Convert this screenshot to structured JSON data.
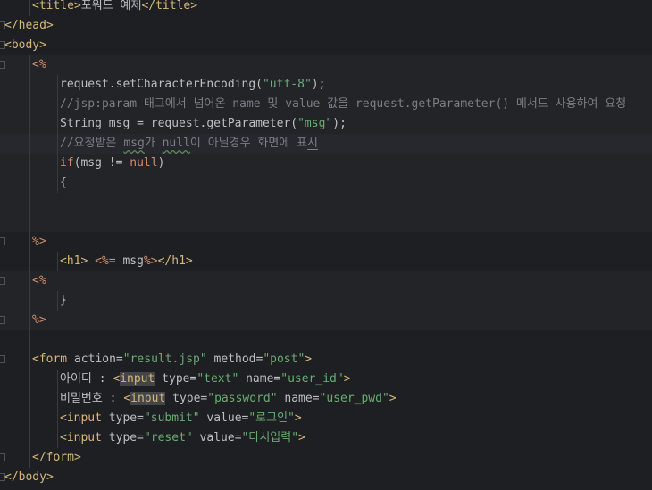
{
  "editor": {
    "lines": [
      {
        "indent": 1,
        "style": "",
        "tokens": [
          {
            "t": "<title>",
            "c": "tag"
          },
          {
            "t": "포워드 예제",
            "c": "attr"
          },
          {
            "t": "</title>",
            "c": "tag"
          }
        ]
      },
      {
        "indent": 0,
        "fold": true,
        "style": "",
        "tokens": [
          {
            "t": "</head>",
            "c": "tag"
          }
        ]
      },
      {
        "indent": 0,
        "fold": true,
        "style": "",
        "tokens": [
          {
            "t": "<body>",
            "c": "tag"
          }
        ]
      },
      {
        "indent": 1,
        "fold": true,
        "style": "emb",
        "tokens": [
          {
            "t": "<%",
            "c": "delim"
          }
        ]
      },
      {
        "indent": 2,
        "style": "emb",
        "tokens": [
          {
            "t": "request.setCharacterEncoding(",
            "c": "attr"
          },
          {
            "t": "\"utf-8\"",
            "c": "str"
          },
          {
            "t": ");",
            "c": "attr"
          }
        ]
      },
      {
        "indent": 2,
        "style": "emb",
        "tokens": [
          {
            "t": "//jsp:param 태그에서 넘어온 name 및 value 값을 request.getParameter() 메서드 사용하여 요청",
            "c": "cmt"
          }
        ]
      },
      {
        "indent": 2,
        "style": "emb",
        "tokens": [
          {
            "t": "String msg = request.getParameter(",
            "c": "attr"
          },
          {
            "t": "\"msg\"",
            "c": "str"
          },
          {
            "t": ");",
            "c": "attr"
          }
        ]
      },
      {
        "indent": 2,
        "style": "caret",
        "tokens": [
          {
            "t": "//요청받은 ",
            "c": "cmt"
          },
          {
            "t": "msg",
            "c": "cmt typo"
          },
          {
            "t": "가 ",
            "c": "cmt"
          },
          {
            "t": "null",
            "c": "cmt typo"
          },
          {
            "t": "이 아닐경우 화면에 표",
            "c": "cmt"
          },
          {
            "t": "시",
            "c": "cmt under"
          }
        ]
      },
      {
        "indent": 2,
        "style": "emb",
        "tokens": [
          {
            "t": "if",
            "c": "kw"
          },
          {
            "t": "(msg != ",
            "c": "attr"
          },
          {
            "t": "null",
            "c": "kw"
          },
          {
            "t": ")",
            "c": "attr"
          }
        ]
      },
      {
        "indent": 2,
        "style": "emb",
        "tokens": [
          {
            "t": "{",
            "c": "attr"
          }
        ]
      },
      {
        "indent": 1,
        "style": "emb",
        "tokens": []
      },
      {
        "indent": 1,
        "style": "emb",
        "tokens": []
      },
      {
        "indent": 1,
        "fold": true,
        "style": "",
        "tokens": [
          {
            "t": "%>",
            "c": "delim"
          }
        ]
      },
      {
        "indent": 2,
        "style": "",
        "tokens": [
          {
            "t": "<h1>",
            "c": "tag"
          },
          {
            "t": " ",
            "c": "attr"
          },
          {
            "t": "<%=",
            "c": "delim"
          },
          {
            "t": " msg",
            "c": "attr"
          },
          {
            "t": "%>",
            "c": "delim"
          },
          {
            "t": "</h1>",
            "c": "tag"
          }
        ]
      },
      {
        "indent": 1,
        "fold": true,
        "style": "emb",
        "tokens": [
          {
            "t": "<%",
            "c": "delim"
          }
        ]
      },
      {
        "indent": 2,
        "style": "emb",
        "tokens": [
          {
            "t": "}",
            "c": "attr"
          }
        ]
      },
      {
        "indent": 1,
        "fold": true,
        "style": "emb",
        "tokens": [
          {
            "t": "%>",
            "c": "delim"
          }
        ]
      },
      {
        "indent": 1,
        "style": "",
        "tokens": []
      },
      {
        "indent": 1,
        "fold": true,
        "style": "",
        "tokens": [
          {
            "t": "<form ",
            "c": "tag"
          },
          {
            "t": "action=",
            "c": "attr"
          },
          {
            "t": "\"result.jsp\"",
            "c": "str"
          },
          {
            "t": " method=",
            "c": "attr"
          },
          {
            "t": "\"post\"",
            "c": "str"
          },
          {
            "t": ">",
            "c": "tag"
          }
        ]
      },
      {
        "indent": 2,
        "style": "",
        "tokens": [
          {
            "t": "아이디 : ",
            "c": "attr"
          },
          {
            "t": "<",
            "c": "tag"
          },
          {
            "t": "input",
            "c": "tag hl"
          },
          {
            "t": " type=",
            "c": "attr"
          },
          {
            "t": "\"text\"",
            "c": "str"
          },
          {
            "t": " name=",
            "c": "attr"
          },
          {
            "t": "\"user_id\"",
            "c": "str"
          },
          {
            "t": ">",
            "c": "tag"
          }
        ]
      },
      {
        "indent": 2,
        "style": "",
        "tokens": [
          {
            "t": "비밀번호 : ",
            "c": "attr"
          },
          {
            "t": "<",
            "c": "tag"
          },
          {
            "t": "input",
            "c": "tag hl"
          },
          {
            "t": " type=",
            "c": "attr"
          },
          {
            "t": "\"password\"",
            "c": "str"
          },
          {
            "t": " name=",
            "c": "attr"
          },
          {
            "t": "\"user_pwd\"",
            "c": "str"
          },
          {
            "t": ">",
            "c": "tag"
          }
        ]
      },
      {
        "indent": 2,
        "style": "",
        "tokens": [
          {
            "t": "<input ",
            "c": "tag"
          },
          {
            "t": "type=",
            "c": "attr"
          },
          {
            "t": "\"submit\"",
            "c": "str"
          },
          {
            "t": " value=",
            "c": "attr"
          },
          {
            "t": "\"로그인\"",
            "c": "str"
          },
          {
            "t": ">",
            "c": "tag"
          }
        ]
      },
      {
        "indent": 2,
        "style": "",
        "tokens": [
          {
            "t": "<input ",
            "c": "tag"
          },
          {
            "t": "type=",
            "c": "attr"
          },
          {
            "t": "\"reset\"",
            "c": "str"
          },
          {
            "t": " value=",
            "c": "attr"
          },
          {
            "t": "\"다시입력\"",
            "c": "str"
          },
          {
            "t": ">",
            "c": "tag"
          }
        ]
      },
      {
        "indent": 1,
        "fold": true,
        "style": "",
        "tokens": [
          {
            "t": "</form>",
            "c": "tag"
          }
        ]
      },
      {
        "indent": 0,
        "fold": true,
        "style": "",
        "tokens": [
          {
            "t": "</body>",
            "c": "tag"
          }
        ]
      }
    ]
  }
}
